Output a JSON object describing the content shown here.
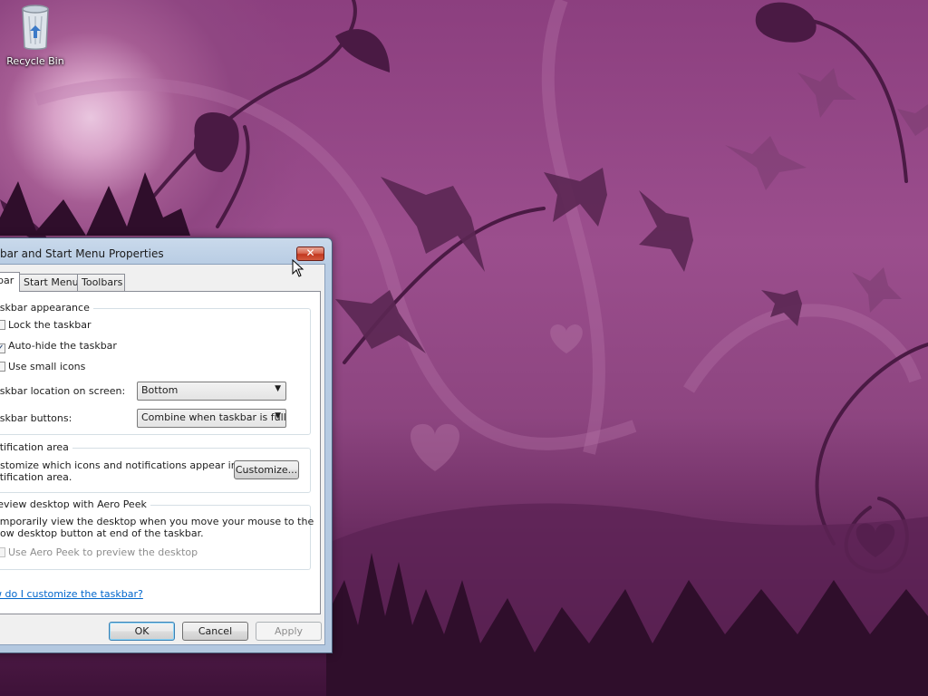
{
  "desktop": {
    "icons": [
      {
        "label": "Recycle Bin",
        "icon": "recycle-bin-icon"
      }
    ]
  },
  "dialog": {
    "title": "kbar and Start Menu Properties",
    "close_glyph": "✕",
    "tabs": [
      {
        "label": "bar",
        "active": true
      },
      {
        "label": "Start Menu",
        "active": false
      },
      {
        "label": "Toolbars",
        "active": false
      }
    ],
    "appearance": {
      "title": "askbar appearance",
      "lock": {
        "label": "Lock the taskbar",
        "checked": false
      },
      "autohide": {
        "label": "Auto-hide the taskbar",
        "checked": true
      },
      "small_icons": {
        "label": "Use small icons",
        "checked": false
      },
      "location_label": "askbar location on screen:",
      "location_value": "Bottom",
      "buttons_label": "askbar buttons:",
      "buttons_value": "Combine when taskbar is full"
    },
    "notification": {
      "title": "otification area",
      "text_line1": "ustomize which icons and notifications appear in the",
      "text_line2": "otification area.",
      "customize_label": "Customize..."
    },
    "aero_peek": {
      "title": "review desktop with Aero Peek",
      "text_line1": "emporarily view the desktop when you move your mouse to the",
      "text_line2": "how desktop button at end of the taskbar.",
      "checkbox_label": "Use Aero Peek to preview the desktop",
      "checked": false,
      "enabled": false
    },
    "help_link": "w do I customize the taskbar?",
    "ok_label": "OK",
    "cancel_label": "Cancel",
    "apply_label": "Apply"
  },
  "colors": {
    "wallpaper_primary": "#8c3f7f",
    "wallpaper_dark": "#3e1238",
    "silhouette": "#4a1a44",
    "link": "#0066cc"
  }
}
